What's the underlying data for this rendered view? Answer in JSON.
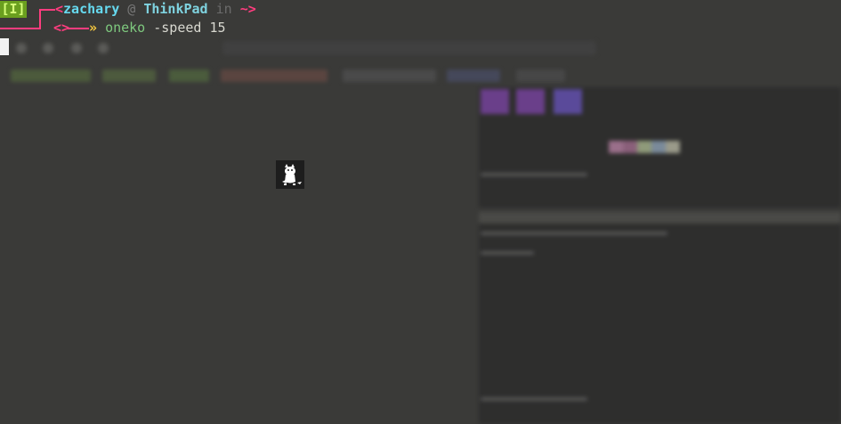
{
  "terminal": {
    "mode_indicator": "[I]",
    "prompt_open": "<",
    "user": "zachary",
    "at": "@",
    "host": "ThinkPad",
    "in": "in",
    "cwd": "~",
    "prompt_close": ">",
    "continuation": "<>",
    "arrow": "»",
    "command": "oneko",
    "arguments": "-speed 15"
  },
  "sprite": {
    "icon": "oneko-cat-icon"
  },
  "colors": {
    "accent_pink": "#ff3d7f",
    "mode_green": "#6a9f1f",
    "user_cyan": "#66d9ef",
    "arrow_yellow": "#ffcf40",
    "command_green": "#7ec87e",
    "background": "#3a3a38"
  }
}
